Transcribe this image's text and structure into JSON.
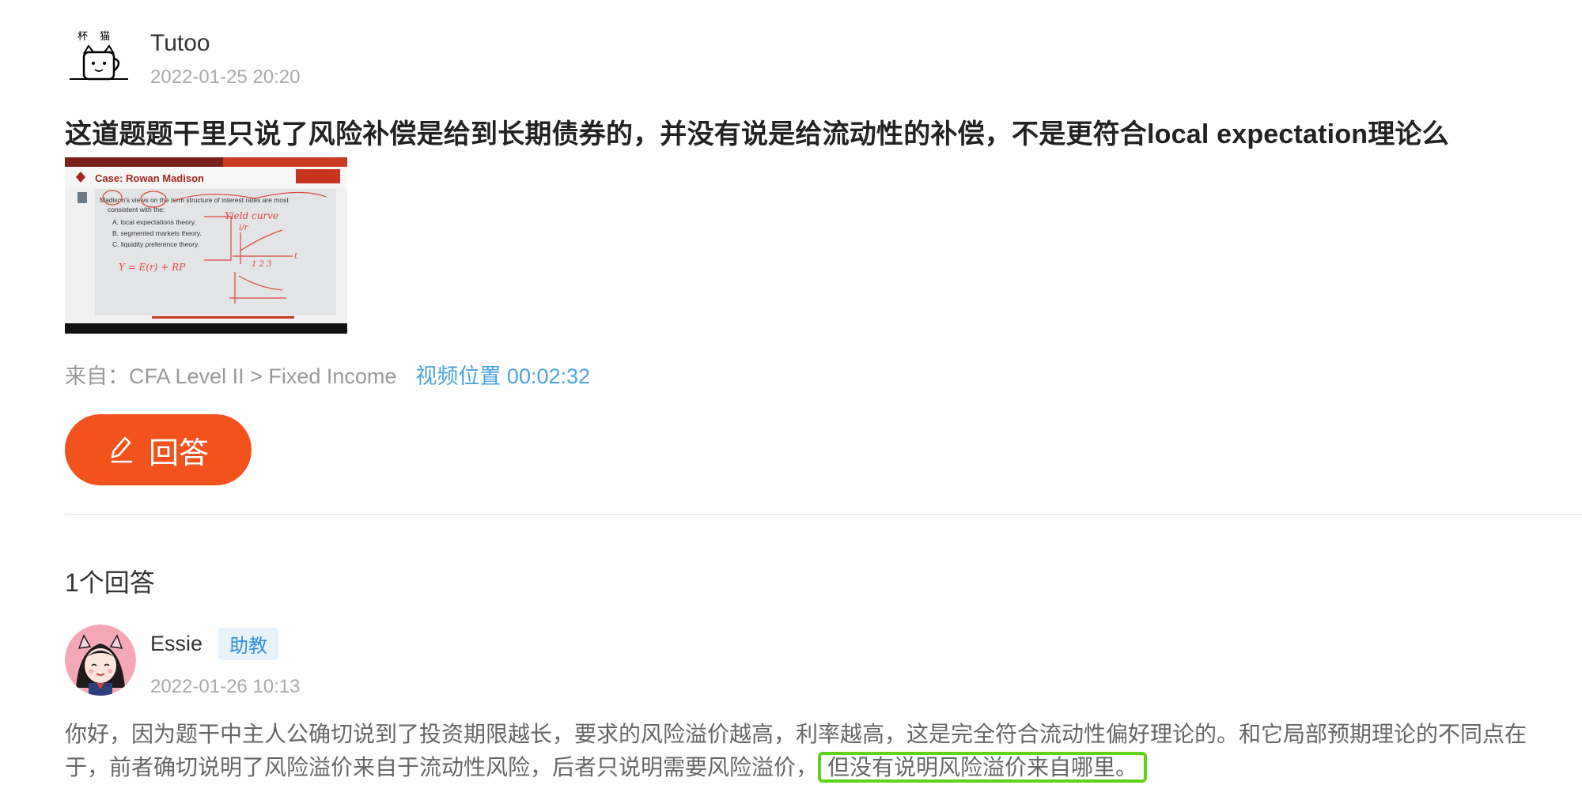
{
  "question": {
    "author_name": "Tutoo",
    "author_time": "2022-01-25 20:20",
    "title": "这道题题干里只说了风险补偿是给到长期债券的，并没有说是给流动性的补偿，不是更符合local expectation理论么",
    "thumbnail": {
      "header": "Case: Rowan Madison",
      "lines": [
        "Madison's views on the term structure of interest rates are most",
        "consistent with the:",
        "A. local expectations theory.",
        "B. segmented markets theory.",
        "C. liquidity preference theory."
      ],
      "handwriting_1": "Yield curve",
      "handwriting_2": "Y = E(r) + RP",
      "axis_label": "1 2 3",
      "axis_t": "t",
      "axis_y": "i/r"
    },
    "source_label": "来自：CFA Level II > Fixed Income",
    "video_position": "视频位置 00:02:32"
  },
  "answer_button": {
    "label": "回答",
    "icon": "pen-icon"
  },
  "answers_count": "1个回答",
  "answer": {
    "author_name": "Essie",
    "badge": "助教",
    "time": "2022-01-26 10:13",
    "text_main": "你好，因为题干中主人公确切说到了投资期限越长，要求的风险溢价越高，利率越高，这是完全符合流动性偏好理论的。和它局部预期理论的不同点在于，前者确切说明了风险溢价来自于流动性风险，后者只说明需要风险溢价，",
    "text_highlight": "但没有说明风险溢价来自哪里。"
  },
  "colors": {
    "accent": "#f2521c",
    "link": "#4aa3df",
    "badge_text": "#2f8fdc",
    "highlight_border": "#5fd31a"
  }
}
